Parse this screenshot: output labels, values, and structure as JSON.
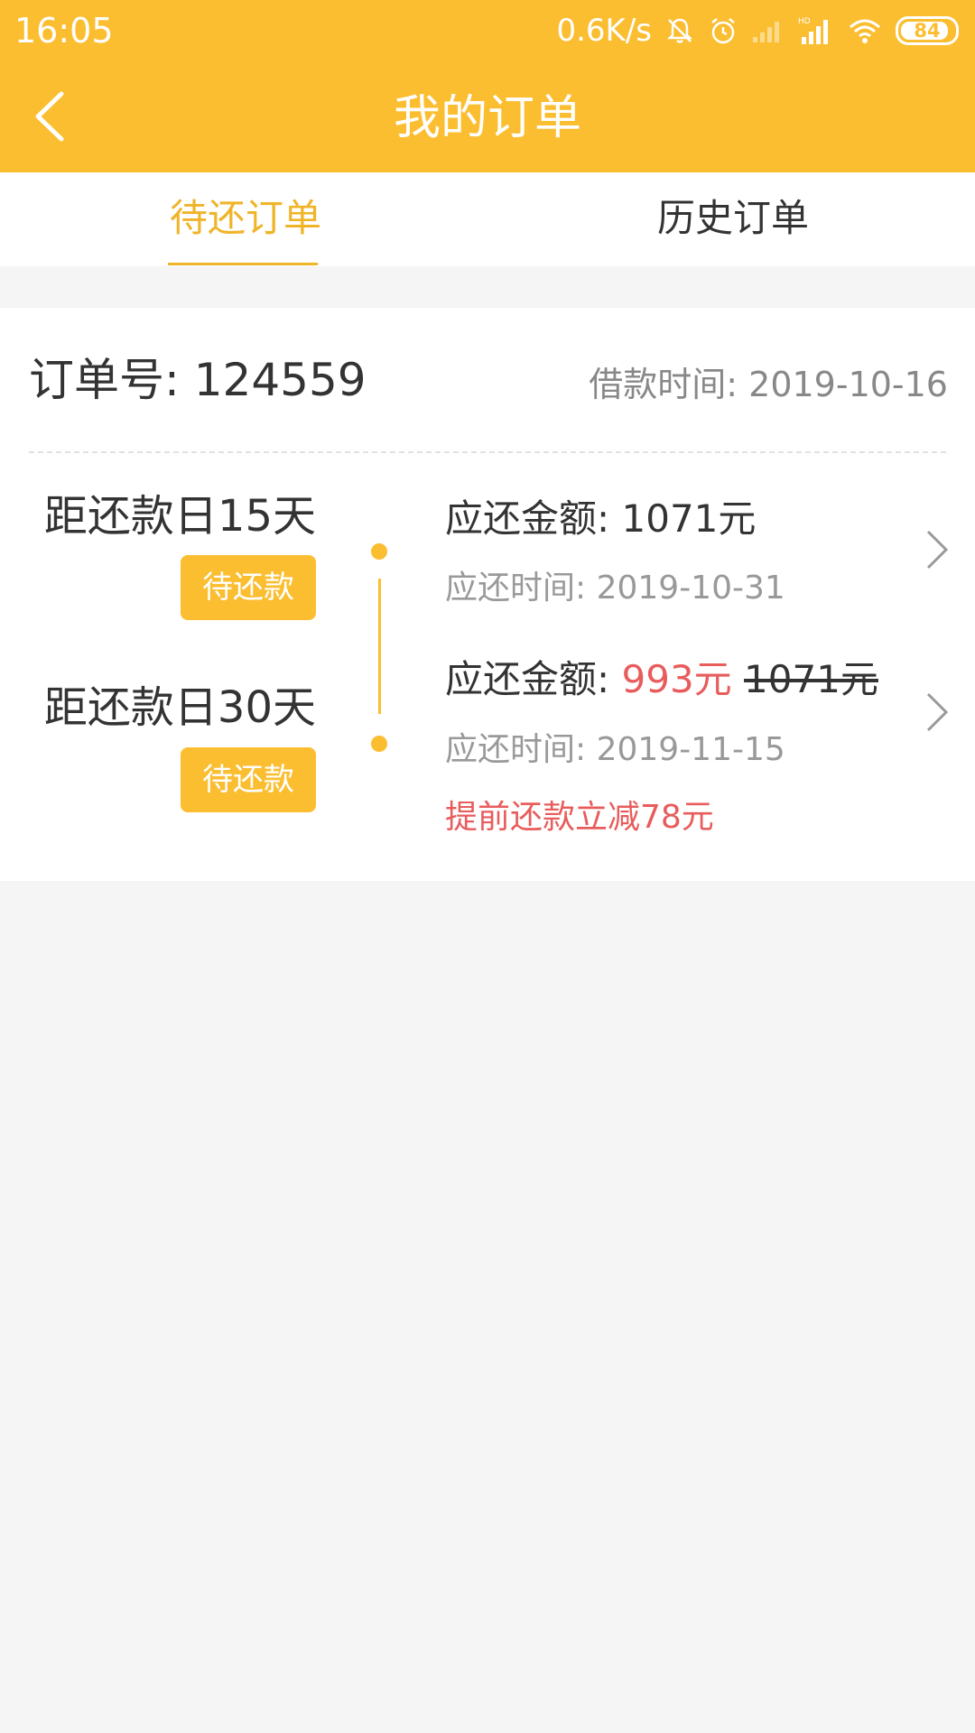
{
  "status_bar": {
    "time": "16:05",
    "net_speed": "0.6K/s",
    "battery": "84",
    "icons": [
      "mute-icon",
      "alarm-icon",
      "signal-icon",
      "hd-signal-icon",
      "wifi-icon",
      "battery-icon"
    ]
  },
  "header": {
    "title": "我的订单",
    "back_icon": "back-arrow-icon"
  },
  "tabs": [
    {
      "label": "待还订单",
      "active": true
    },
    {
      "label": "历史订单",
      "active": false
    }
  ],
  "order": {
    "order_no_label": "订单号: 124559",
    "loan_time": "借款时间: 2019-10-16",
    "installments": [
      {
        "days_left": "距还款日15天",
        "status": "待还款",
        "amount_label": "应还金额:",
        "amount": "1071元",
        "due_time": "应还时间: 2019-10-31"
      },
      {
        "days_left": "距还款日30天",
        "status": "待还款",
        "amount_label": "应还金额:",
        "amount_discounted": "993元",
        "amount_original": "1071元",
        "due_time": "应还时间: 2019-11-15",
        "promo": "提前还款立减78元"
      }
    ]
  },
  "colors": {
    "brand_yellow": "#fbbe31",
    "active_tab": "#f0b429",
    "discount_red": "#e85c5c",
    "background": "#f5f5f5"
  }
}
